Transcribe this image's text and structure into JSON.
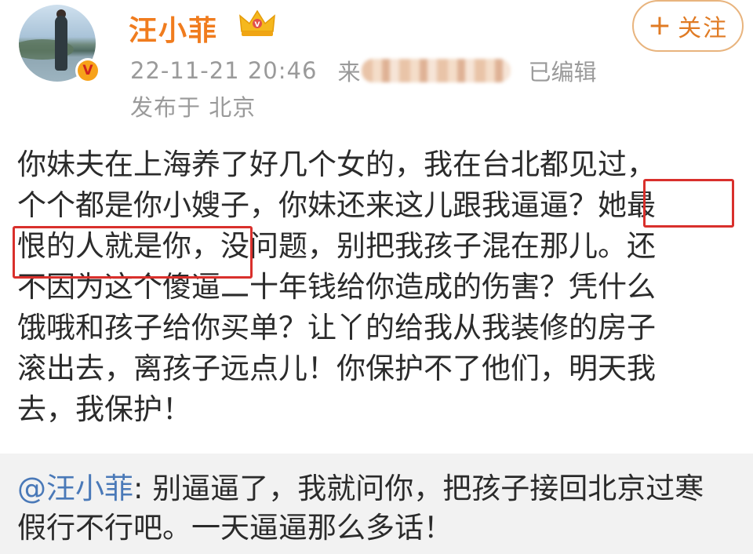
{
  "colors": {
    "name": "#f07c1e",
    "accent": "#e07b24",
    "meta": "#9a9a9a",
    "text": "#2b2b2b",
    "highlight": "#d9302c",
    "mention": "#4a79b8"
  },
  "icons": {
    "verified_badge": "v-badge-icon",
    "crown_badge": "crown-icon",
    "follow_plus": "plus-icon"
  },
  "post": {
    "author": "汪小菲",
    "follow_label": "关注",
    "follow_plus": "+",
    "timestamp": "22-11-21 20:46",
    "source_prefix": "来",
    "edited": "已编辑",
    "location": "发布于 北京",
    "body_lines": [
      "你妹夫在上海养了好几个女的，我在台北都见过，",
      "个个都是你小嫂子，你妹还来这儿跟我逼逼？她最",
      "恨的人就是你，没问题，别把我孩子混在那儿。还",
      "不因为这个傻逼二十年钱给你造成的伤害？凭什么",
      "饿哦和孩子给你买单？让丫的给我从我装修的房子",
      "滚出去，离孩子远点儿！你保护不了他们，明天我",
      "去，我保护！"
    ]
  },
  "repost": {
    "mention": "@汪小菲",
    "first_line_rest": ": 别逼逼了，我就问你，把孩子接回北京过寒",
    "second_line": "假行不行吧。一天逼逼那么多话！"
  }
}
